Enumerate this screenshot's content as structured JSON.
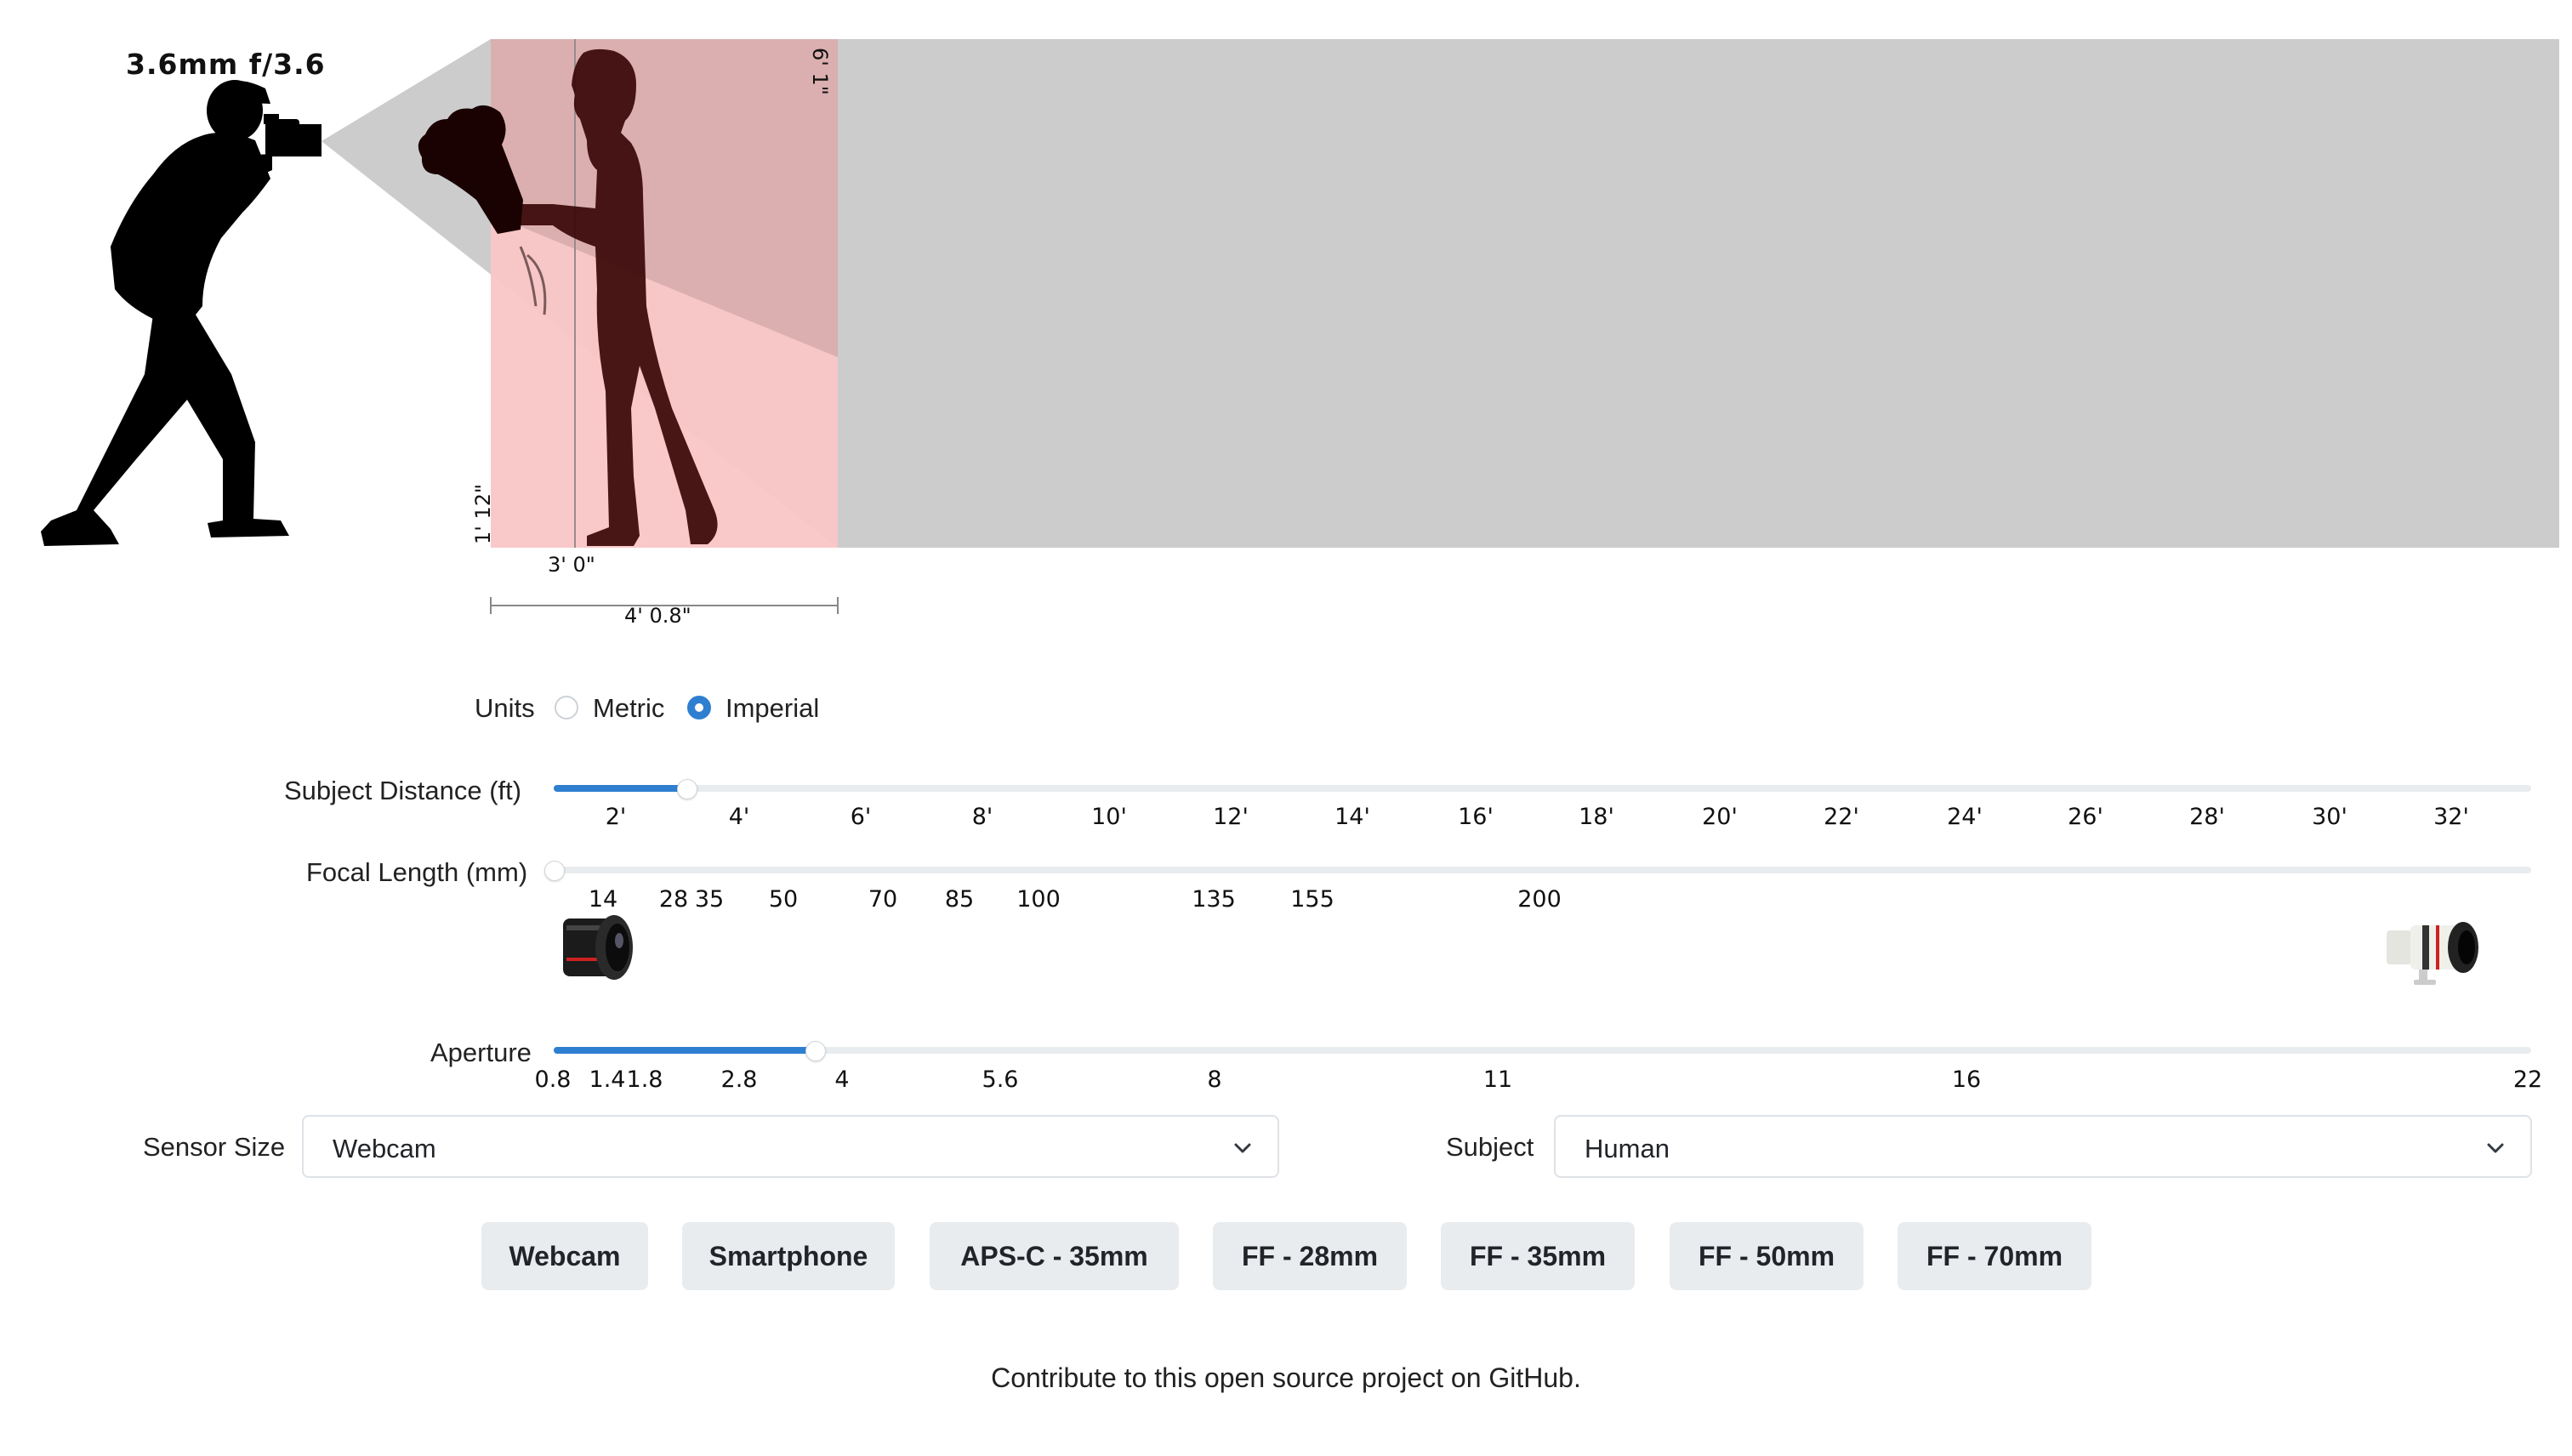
{
  "scene": {
    "lens_readout": "3.6mm f/3.6",
    "frame_height_label": "6' 1\"",
    "bottom_left_label": "1' 12\"",
    "subject_distance_label": "3' 0\"",
    "frame_width_label": "4' 0.8\""
  },
  "units": {
    "label": "Units",
    "options": [
      "Metric",
      "Imperial"
    ],
    "selected": "Imperial"
  },
  "subject_distance": {
    "label": "Subject Distance (ft)",
    "ticks": [
      "2'",
      "4'",
      "6'",
      "8'",
      "10'",
      "12'",
      "14'",
      "16'",
      "18'",
      "20'",
      "22'",
      "24'",
      "26'",
      "28'",
      "30'",
      "32'"
    ],
    "value_fraction": 0.067
  },
  "focal_length": {
    "label": "Focal Length (mm)",
    "ticks": [
      "14",
      "28",
      "35",
      "50",
      "70",
      "85",
      "100",
      "135",
      "155",
      "200"
    ],
    "value_fraction": 0.0
  },
  "aperture": {
    "label": "Aperture",
    "ticks": [
      "0.8",
      "1.4",
      "1.8",
      "2.8",
      "4",
      "5.6",
      "8",
      "11",
      "16",
      "22"
    ],
    "value_fraction": 0.132
  },
  "sensor_size": {
    "label": "Sensor Size",
    "value": "Webcam"
  },
  "subject": {
    "label": "Subject",
    "value": "Human"
  },
  "presets": [
    "Webcam",
    "Smartphone",
    "APS-C - 35mm",
    "FF - 28mm",
    "FF - 35mm",
    "FF - 50mm",
    "FF - 70mm"
  ],
  "footer": {
    "text": "Contribute to this open source project on GitHub."
  },
  "colors": {
    "accent": "#2f7fd0",
    "frustum": "#cccccc",
    "frame": "#f9c6c6",
    "track": "#e9ecef"
  }
}
